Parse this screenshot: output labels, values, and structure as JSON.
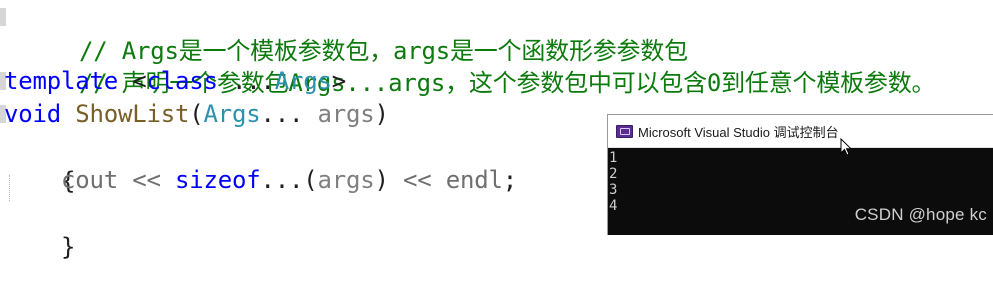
{
  "code": {
    "line1": {
      "comment": "// Args是一个模板参数包，args是一个函数形参参数包"
    },
    "line2": {
      "comment": "// 声明一个参数包Args...args，这个参数包中可以包含0到任意个模板参数。"
    },
    "line3": {
      "kw_template": "template",
      "open": " <",
      "kw_class": "class",
      "dots": " ...",
      "type": "Args",
      "close": ">"
    },
    "line4": {
      "kw_void": "void",
      "space": " ",
      "fn": "ShowList",
      "paren_open": "(",
      "type": "Args",
      "dots": "... ",
      "param": "args",
      "paren_close": ")"
    },
    "line5": {
      "brace": "{"
    },
    "line6": {
      "indent": "    ",
      "cout": "cout",
      "op1": " << ",
      "kw_sizeof": "sizeof",
      "dots": "...(",
      "param": "args",
      "close": ")",
      "op2": " << ",
      "endl": "endl",
      "semi": ";"
    },
    "line7": {
      "brace": "}"
    }
  },
  "console": {
    "title": "Microsoft Visual Studio 调试控制台",
    "icon": "visual-studio-icon",
    "output": [
      "1",
      "2",
      "3",
      "4"
    ]
  },
  "watermark": "CSDN @hope kc",
  "colors": {
    "comment": "#0d7a0d",
    "keyword": "#0000ff",
    "type": "#2b91af",
    "function": "#795e26",
    "console_bg": "#0c0c0c"
  }
}
